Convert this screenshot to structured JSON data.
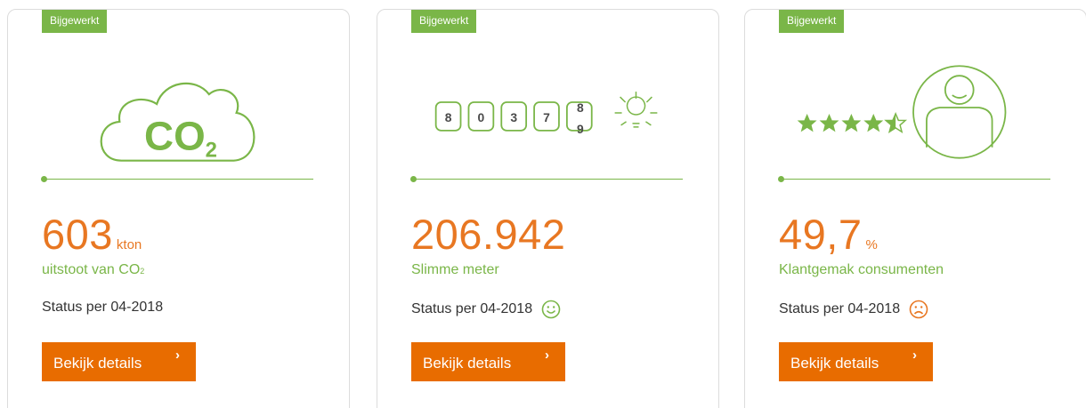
{
  "colors": {
    "green": "#7ab648",
    "orange": "#e87722",
    "button": "#e86c00"
  },
  "cards": [
    {
      "badge": "Bijgewerkt",
      "illustration": "co2-cloud-icon",
      "co2_text": "CO",
      "co2_sub": "2",
      "value": "603",
      "unit": "kton",
      "subtitle": "uitstoot van CO",
      "subtitle_sub": "2",
      "status": "Status per 04-2018",
      "button": "Bekijk details"
    },
    {
      "badge": "Bijgewerkt",
      "illustration": "meter-counter-icon",
      "digits": [
        "8",
        "0",
        "3",
        "7"
      ],
      "rolling_digits": [
        "8",
        "9"
      ],
      "value": "206.942",
      "subtitle": "Slimme meter",
      "status": "Status per 04-2018",
      "status_icon": "happy-smiley-icon",
      "button": "Bekijk details"
    },
    {
      "badge": "Bijgewerkt",
      "illustration": "customer-rating-icon",
      "rating": 4.5,
      "rating_max": 5,
      "value": "49,7",
      "unit": "%",
      "subtitle": "Klantgemak consumenten",
      "status": "Status per 04-2018",
      "status_icon": "sad-smiley-icon",
      "button": "Bekijk details"
    }
  ]
}
